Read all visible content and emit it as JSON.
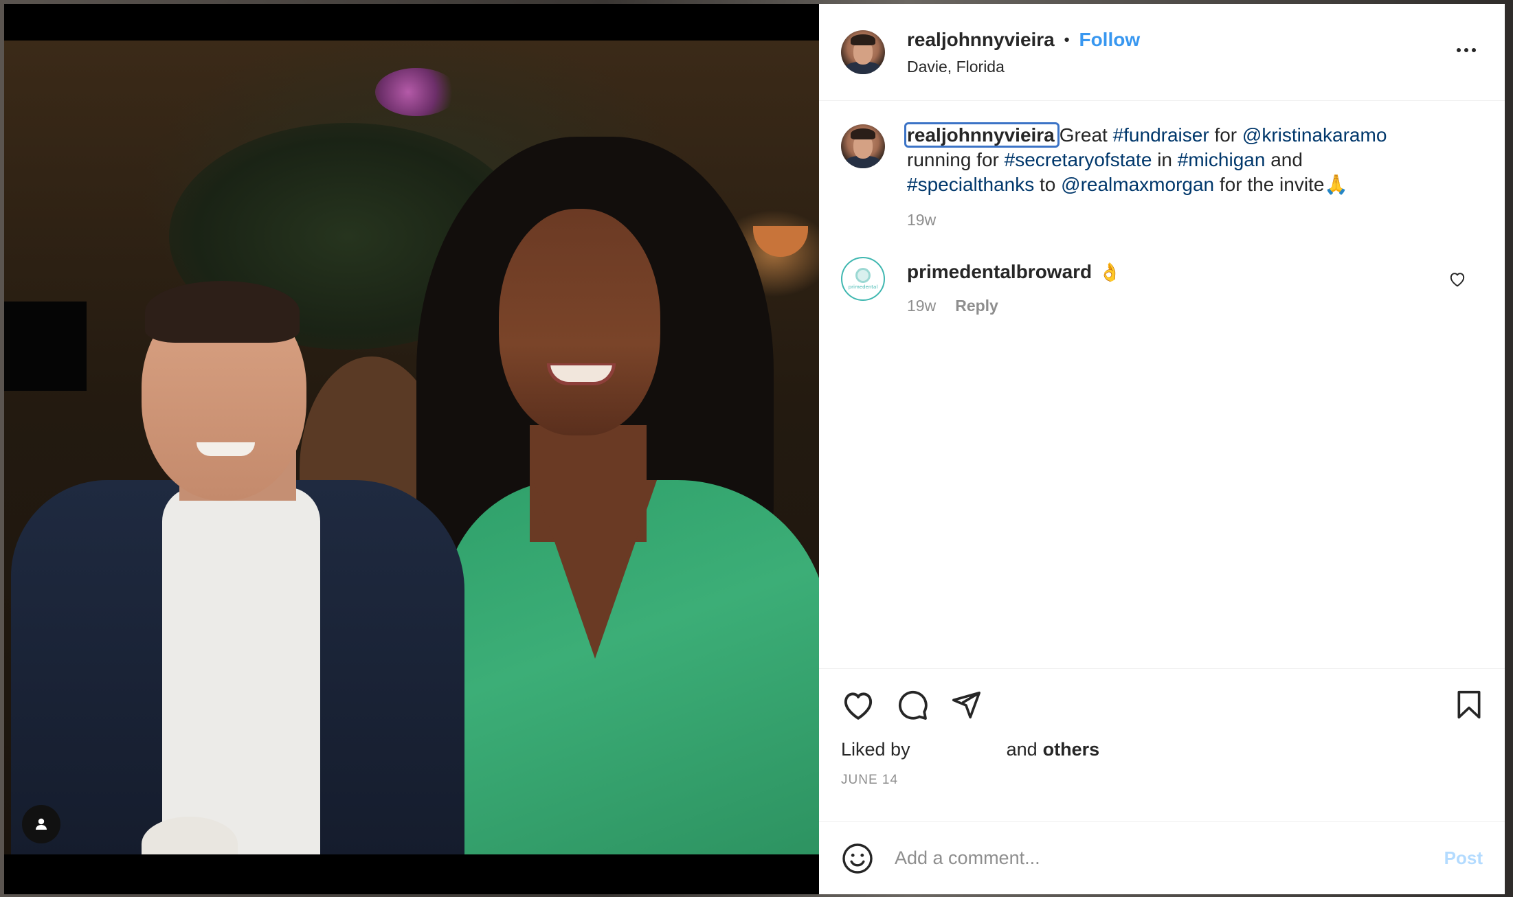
{
  "post": {
    "username": "realjohnnyvieira",
    "separator": "•",
    "follow_label": "Follow",
    "location": "Davie, Florida"
  },
  "caption": {
    "username": "realjohnnyvieira",
    "parts": {
      "t1": "Great ",
      "h1": "#fundraiser",
      "t2": " for ",
      "m1": "@kristinakaramo",
      "t3": " running for ",
      "h2": "#secretaryofstate",
      "t4": " in ",
      "h3": "#michigan",
      "t5": " and ",
      "h4": "#specialthanks",
      "t6": " to ",
      "m2": "@realmaxmorgan",
      "t7": " for the invite🙏"
    },
    "age": "19w"
  },
  "comments": [
    {
      "username": "primedentalbroward",
      "emoji": "👌",
      "age": "19w",
      "reply_label": "Reply",
      "avatar_word": "primedental"
    }
  ],
  "engagement": {
    "liked_prefix": "Liked by",
    "liked_middle": "and",
    "liked_others": "others",
    "date": "JUNE 14"
  },
  "comment_box": {
    "placeholder": "Add a comment...",
    "post_label": "Post"
  },
  "icons": {
    "like": "heart-icon",
    "comment": "comment-bubble-icon",
    "share": "paper-plane-icon",
    "save": "bookmark-icon",
    "emoji": "smiley-icon",
    "more": "ellipsis-icon",
    "user_tag": "user-tag-icon"
  },
  "colors": {
    "accent": "#3897f0",
    "link": "#00376b",
    "muted": "#8e8e8e",
    "post_disabled": "#b3dbff"
  }
}
